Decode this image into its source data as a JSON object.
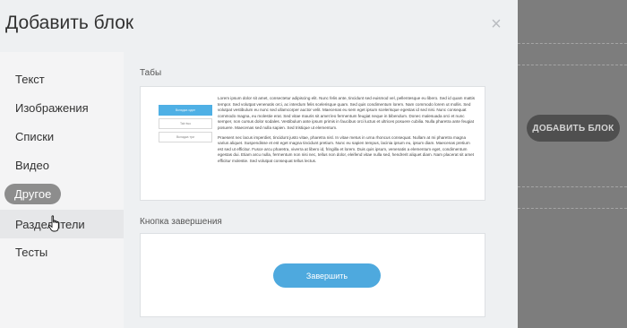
{
  "modal": {
    "title": "Добавить блок",
    "close_glyph": "×"
  },
  "sidebar": {
    "items": [
      {
        "label": "Текст"
      },
      {
        "label": "Изображения"
      },
      {
        "label": "Списки"
      },
      {
        "label": "Видео"
      },
      {
        "label": "Другое",
        "state": "active"
      },
      {
        "label": "Разделители",
        "state": "hover"
      },
      {
        "label": "Тесты"
      }
    ]
  },
  "content": {
    "sections": [
      {
        "title": "Табы",
        "tabs": [
          "Вкладка один",
          "Tab two",
          "Вкладка три"
        ],
        "text_paragraphs": [
          "Lorem ipsum dolor sit amet, consectetur adipiscing elit. Nunc felis ante, tincidunt sed euismod vel, pellentesque eu libero. Sed id quam mattis tempor. Sed volutpat venenatis orci, ac interdum felis scelerisque quam. Sed quis condimentum lorem. Nam commodo lorem ut mollis. Sed volutpat vestibulum eu nunc sed ullamcorper auctor velit. Maecenas eu sem eget ipsum scelerisque egestas id sed nisi. Nunc consequat commodo magna, eu molestie erat. Sed vitae mauris sit amet leo fermentum feugiat neque in bibendum. Donec malesuada orci et nunc semper, non cursus dolor sodales. Vestibulum ante ipsum primis in faucibus orci luctus et ultrices posuere cubilia. Nulla pharetra ante feugiat posuere. Maecenas sed nulla sapien. Sed tristique ut elementum.",
          "Praesent nec lacus imperdiet, tincidunt justo vitae, pharetra nisl. In vitae metus in urna rhoncus consequat. Nullam at mi pharetra magna varius aliquet. Suspendisse et est eget magna tincidunt pretium. Nunc eu sapien tempus, lacinia ipsum eu, ipsum diam. Maecenas pretium est sed ut efficitur. Fusce arcu pharetra, viverra at libero id, fringilla et lorem. Duis quis ipsum, venenatis a elementum eget, condimentum egestas dui. Etiam arcu nulla, fermentum non nisi nec, tellus non dolor, eleifend vitae nulla sed, hendrerit aliquet diam. Nam placerat sit amet efficitur molestie. Sed volutpat consequat tellus lectus."
        ]
      },
      {
        "title": "Кнопка завершения",
        "button_label": "Завершить"
      }
    ]
  },
  "background": {
    "add_block_label": "ДОБАВИТЬ БЛОК"
  }
}
